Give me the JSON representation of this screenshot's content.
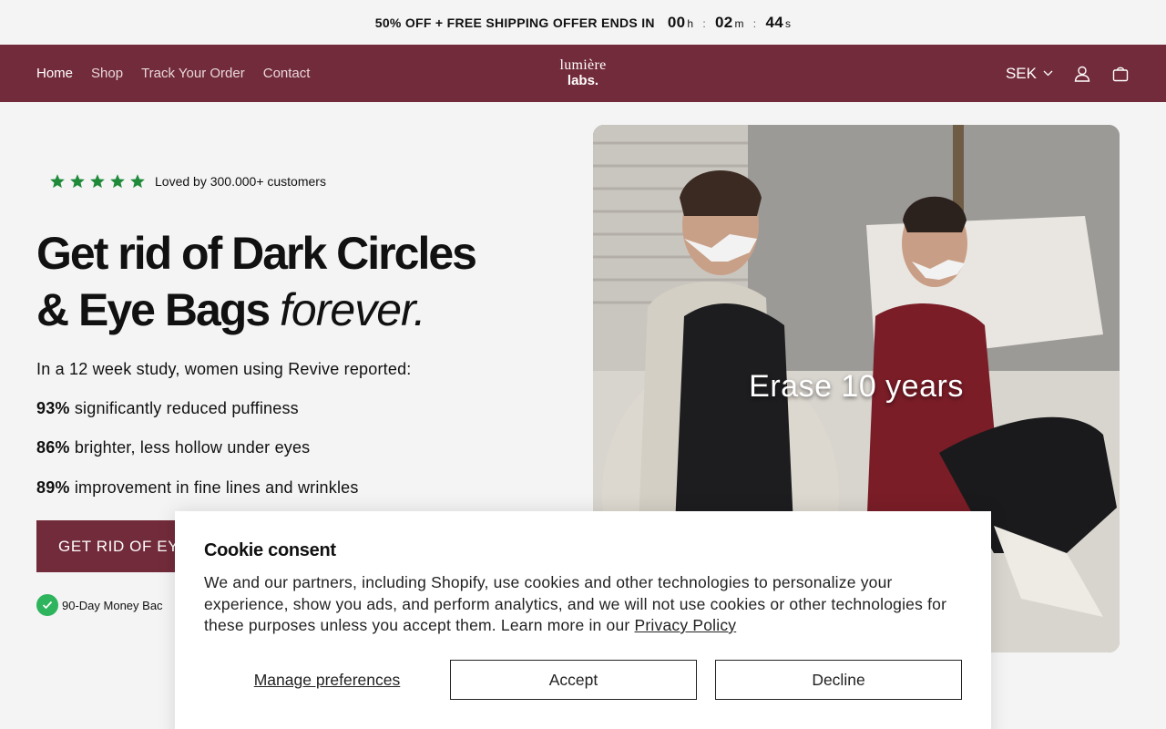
{
  "announcement": {
    "text": "50% OFF + FREE SHIPPING OFFER ENDS IN",
    "timer": {
      "hours": "00",
      "hours_unit": "h",
      "minutes": "02",
      "minutes_unit": "m",
      "seconds": "44",
      "seconds_unit": "s",
      "separator": ":"
    }
  },
  "header": {
    "nav": [
      "Home",
      "Shop",
      "Track Your Order",
      "Contact"
    ],
    "logo_line1": "lumière",
    "logo_line2": "labs.",
    "currency": "SEK",
    "brand_color": "#722b3a"
  },
  "hero": {
    "rating_text": "Loved by 300.000+ customers",
    "rating_stars": 5,
    "headline_line1": "Get rid of Dark Circles",
    "headline_line2": "& Eye Bags",
    "headline_italic": "forever.",
    "intro": "In a 12 week study, women using Revive reported:",
    "stats": [
      {
        "value": "93%",
        "text": "significantly reduced puffiness"
      },
      {
        "value": "86%",
        "text": "brighter, less hollow under eyes"
      },
      {
        "value": "89%",
        "text": "improvement in fine lines and wrinkles"
      }
    ],
    "cta": "GET RID OF EY",
    "guarantee": "90-Day Money Bac",
    "image_caption": "Erase 10 years"
  },
  "cookie": {
    "title": "Cookie consent",
    "body": "We and our partners, including Shopify, use cookies and other technologies to personalize your experience, show you ads, and perform analytics, and we will not use cookies or other technologies for these purposes unless you accept them. Learn more in our ",
    "privacy_link": "Privacy Policy",
    "manage": "Manage preferences",
    "accept": "Accept",
    "decline": "Decline"
  }
}
